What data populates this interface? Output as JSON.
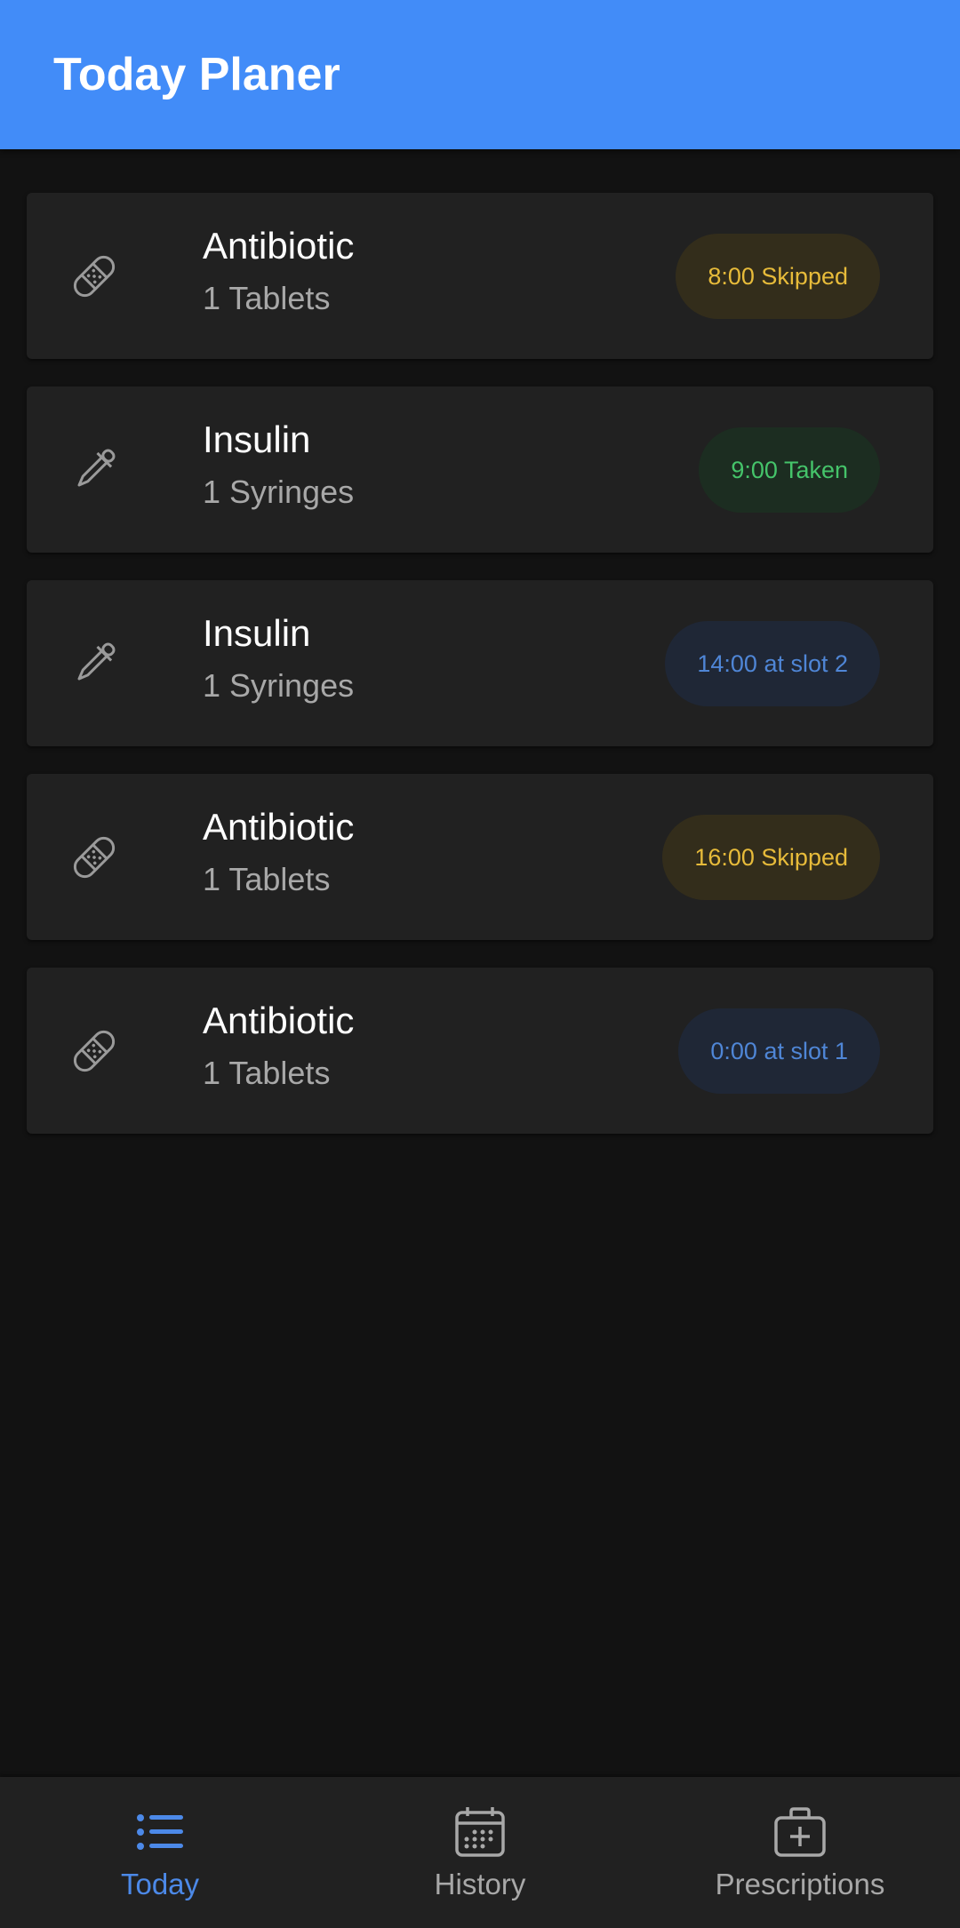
{
  "app": {
    "title": "Today Planer"
  },
  "colors": {
    "primary": "#428cf8",
    "background": "#121212",
    "card": "#212121",
    "skipped": "#e7bb3a",
    "taken": "#45c46a",
    "slot": "#4f86d6"
  },
  "medications": [
    {
      "name": "Antibiotic",
      "dose": "1 Tablets",
      "status": "8:00 Skipped",
      "status_type": "skipped",
      "icon": "bandage-icon"
    },
    {
      "name": "Insulin",
      "dose": "1 Syringes",
      "status": "9:00 Taken",
      "status_type": "taken",
      "icon": "dropper-icon"
    },
    {
      "name": "Insulin",
      "dose": "1 Syringes",
      "status": "14:00 at slot 2",
      "status_type": "slot",
      "icon": "dropper-icon"
    },
    {
      "name": "Antibiotic",
      "dose": "1 Tablets",
      "status": "16:00 Skipped",
      "status_type": "skipped",
      "icon": "bandage-icon"
    },
    {
      "name": "Antibiotic",
      "dose": "1 Tablets",
      "status": "0:00 at slot 1",
      "status_type": "slot",
      "icon": "bandage-icon"
    }
  ],
  "nav": {
    "items": [
      {
        "label": "Today",
        "icon": "list-icon",
        "active": true
      },
      {
        "label": "History",
        "icon": "calendar-icon",
        "active": false
      },
      {
        "label": "Prescriptions",
        "icon": "medical-bag-icon",
        "active": false
      }
    ]
  }
}
